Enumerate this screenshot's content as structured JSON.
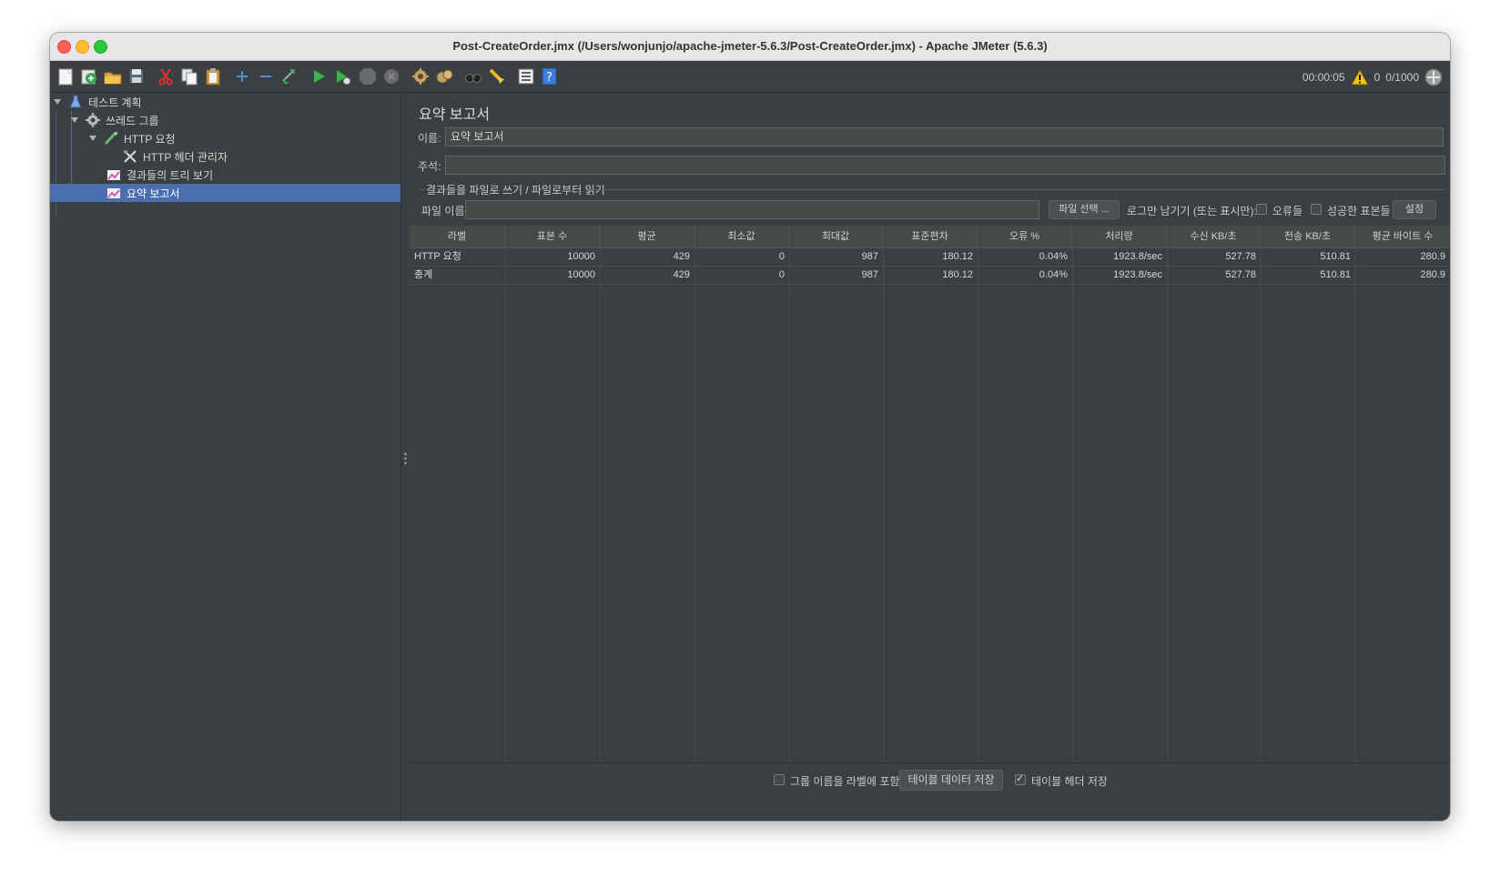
{
  "window": {
    "title": "Post-CreateOrder.jmx (/Users/wonjunjo/apache-jmeter-5.6.3/Post-CreateOrder.jmx) - Apache JMeter (5.6.3)"
  },
  "toolbar": {
    "icons": [
      "new-icon",
      "templates-icon",
      "open-icon",
      "save-icon",
      "cut-icon",
      "copy-icon",
      "paste-icon",
      "expand-icon",
      "collapse-icon",
      "toggle-icon",
      "start-icon",
      "start-no-timers-icon",
      "stop-icon",
      "shutdown-icon",
      "clear-icon",
      "clear-all-icon",
      "search-icon",
      "reset-search-icon",
      "function-helper-icon",
      "help-icon"
    ],
    "status": {
      "elapsed": "00:00:05",
      "warnings": "0",
      "threads": "0/1000"
    }
  },
  "tree": {
    "items": [
      {
        "label": "테스트 계획",
        "icon": "test-plan-icon"
      },
      {
        "label": "쓰레드 그룹",
        "icon": "thread-group-icon"
      },
      {
        "label": "HTTP 요청",
        "icon": "http-sampler-icon"
      },
      {
        "label": "HTTP 헤더 관리자",
        "icon": "header-manager-icon"
      },
      {
        "label": "결과들의 트리 보기",
        "icon": "listener-icon"
      },
      {
        "label": "요약 보고서",
        "icon": "listener-icon"
      }
    ],
    "selected_index": 5
  },
  "panel": {
    "title": "요약 보고서",
    "name_label": "이름:",
    "name_value": "요약 보고서",
    "comment_label": "주석:",
    "comment_value": "",
    "file_group_label": "결과들을 파일로 쓰기 / 파일로부터 읽기",
    "filename_label": "파일 이름",
    "filename_value": "",
    "browse_button": "파일 선택 ...",
    "log_only_label": "로그만 남기기 (또는 표시만):",
    "errors_label": "오류들",
    "successes_label": "성공한 표본들",
    "configure_button": "설정"
  },
  "table": {
    "headers": [
      "라벨",
      "표본 수",
      "평균",
      "최소값",
      "최대값",
      "표준편차",
      "오류 %",
      "처리량",
      "수신 KB/초",
      "전송 KB/초",
      "평균 바이트 수"
    ],
    "rows": [
      [
        "HTTP 요청",
        "10000",
        "429",
        "0",
        "987",
        "180.12",
        "0.04%",
        "1923.8/sec",
        "527.78",
        "510.81",
        "280.9"
      ],
      [
        "총계",
        "10000",
        "429",
        "0",
        "987",
        "180.12",
        "0.04%",
        "1923.8/sec",
        "527.78",
        "510.81",
        "280.9"
      ]
    ]
  },
  "footer": {
    "include_group_label": "그룹 이름을 라벨에 포함?",
    "include_group_checked": false,
    "save_table_button": "테이블 데이터 저장",
    "save_header_label": "테이블 헤더 저장",
    "save_header_checked": true
  }
}
